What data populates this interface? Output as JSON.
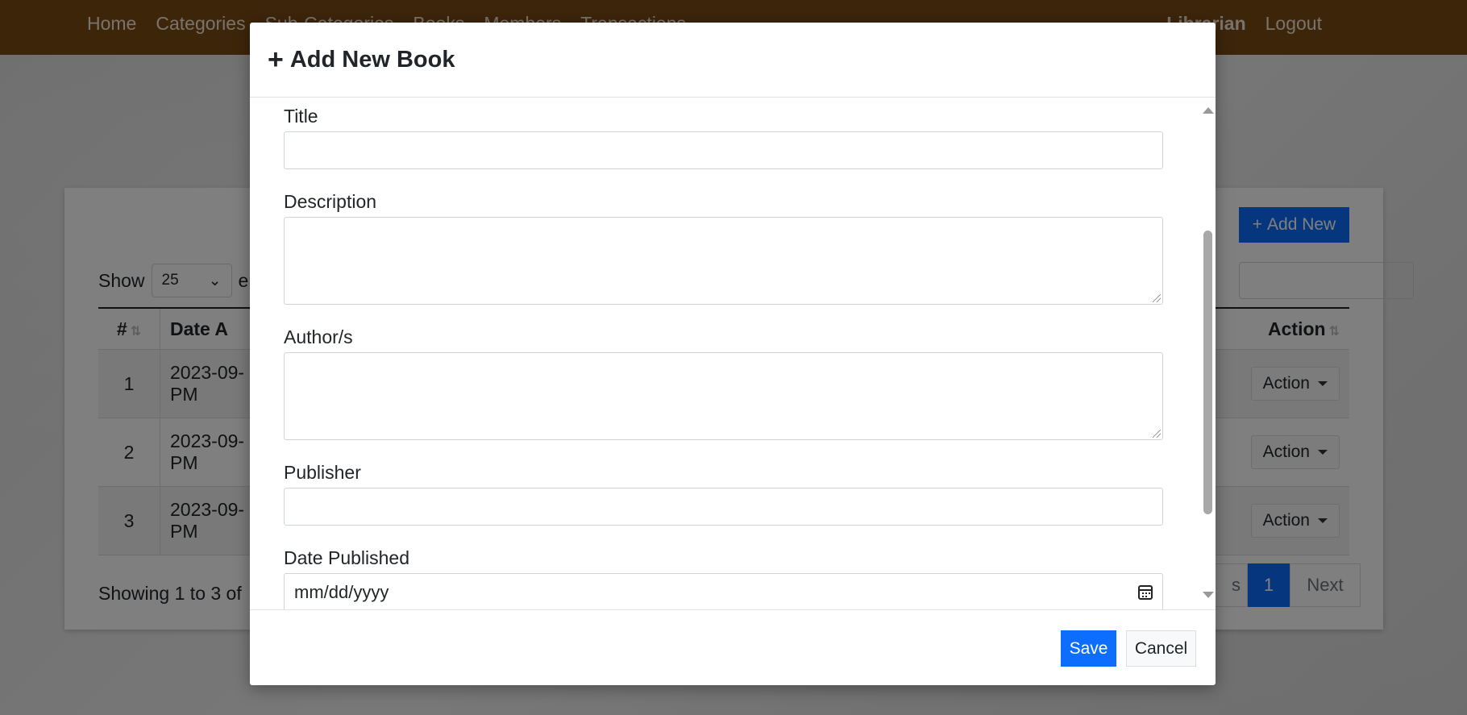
{
  "nav": {
    "links": [
      "Home",
      "Categories",
      "Sub-Categories",
      "Books",
      "Members",
      "Transactions"
    ],
    "user": "Librarian",
    "logout": "Logout"
  },
  "page": {
    "add_new_label": "Add New",
    "show_label": "Show",
    "entries_value": "25",
    "entries_suffix": "er",
    "table": {
      "headers": [
        "#",
        "Date A",
        "Action"
      ],
      "rows": [
        {
          "num": "1",
          "date": "2023-09-",
          "time": "PM",
          "action": "Action"
        },
        {
          "num": "2",
          "date": "2023-09-",
          "time": "PM",
          "action": "Action"
        },
        {
          "num": "3",
          "date": "2023-09-",
          "time": "PM",
          "action": "Action"
        }
      ]
    },
    "showing_text": "Showing 1 to 3 of",
    "pager": {
      "prev": "s",
      "current": "1",
      "next": "Next"
    }
  },
  "modal": {
    "title": "Add New Book",
    "fields": {
      "title_label": "Title",
      "description_label": "Description",
      "authors_label": "Author/s",
      "publisher_label": "Publisher",
      "date_published_label": "Date Published",
      "date_placeholder": "mm/dd/yyyy"
    },
    "save_label": "Save",
    "cancel_label": "Cancel"
  },
  "colors": {
    "nav_bg": "#7a4a14",
    "primary": "#0d6efd",
    "backdrop": "rgba(0,0,0,0.5)"
  }
}
